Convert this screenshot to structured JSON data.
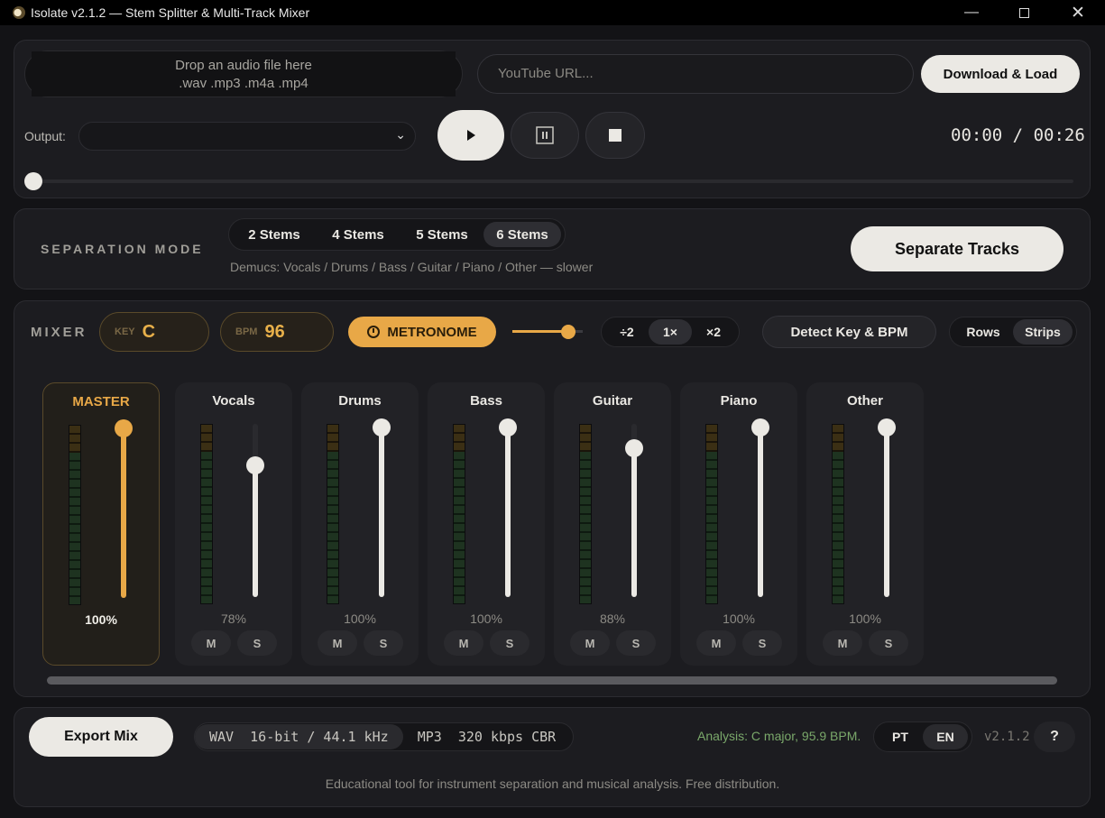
{
  "window": {
    "title": "Isolate v2.1.2 — Stem Splitter & Multi-Track Mixer"
  },
  "input": {
    "drop_line1": "Drop an audio file here",
    "drop_line2": ".wav .mp3 .m4a .mp4",
    "url_placeholder": "YouTube URL...",
    "download_label": "Download & Load"
  },
  "transport": {
    "output_label": "Output:",
    "output_value": "",
    "time_current": "00:00",
    "time_separator": "/",
    "time_total": "00:26",
    "progress": 0
  },
  "separation": {
    "label": "SEPARATION MODE",
    "modes": [
      "2 Stems",
      "4 Stems",
      "5 Stems",
      "6 Stems"
    ],
    "selected": "6 Stems",
    "description": "Demucs: Vocals / Drums / Bass / Guitar / Piano / Other — slower",
    "separate_label": "Separate Tracks"
  },
  "mixer": {
    "label": "MIXER",
    "key_label": "KEY",
    "key_value": "C",
    "bpm_label": "BPM",
    "bpm_value": "96",
    "metronome_label": "METRONOME",
    "metronome_volume": 0.8,
    "tempo_options": [
      "÷2",
      "1×",
      "×2"
    ],
    "tempo_selected": "1×",
    "detect_label": "Detect Key & BPM",
    "view_options": [
      "Rows",
      "Strips"
    ],
    "view_selected": "Strips",
    "mute_label": "M",
    "solo_label": "S",
    "channels": [
      {
        "name": "MASTER",
        "level": 1.0,
        "pct": "100%"
      },
      {
        "name": "Vocals",
        "level": 0.78,
        "pct": "78%"
      },
      {
        "name": "Drums",
        "level": 1.0,
        "pct": "100%"
      },
      {
        "name": "Bass",
        "level": 1.0,
        "pct": "100%"
      },
      {
        "name": "Guitar",
        "level": 0.88,
        "pct": "88%"
      },
      {
        "name": "Piano",
        "level": 1.0,
        "pct": "100%"
      },
      {
        "name": "Other",
        "level": 1.0,
        "pct": "100%"
      }
    ]
  },
  "export": {
    "label": "Export Mix",
    "formats": [
      {
        "codec": "WAV",
        "spec": "16-bit / 44.1 kHz"
      },
      {
        "codec": "MP3",
        "spec": "320 kbps CBR"
      }
    ],
    "selected": "WAV",
    "analysis": "Analysis: C major, 95.9 BPM.",
    "languages": [
      "PT",
      "EN"
    ],
    "language_selected": "EN",
    "version": "v2.1.2",
    "help_label": "?"
  },
  "footer": {
    "text": "Educational tool for instrument separation and musical analysis. Free distribution."
  },
  "colors": {
    "accent": "#e8a847",
    "background": "#131316",
    "panel": "#1c1c20",
    "analysis_text": "#7aa86a"
  }
}
